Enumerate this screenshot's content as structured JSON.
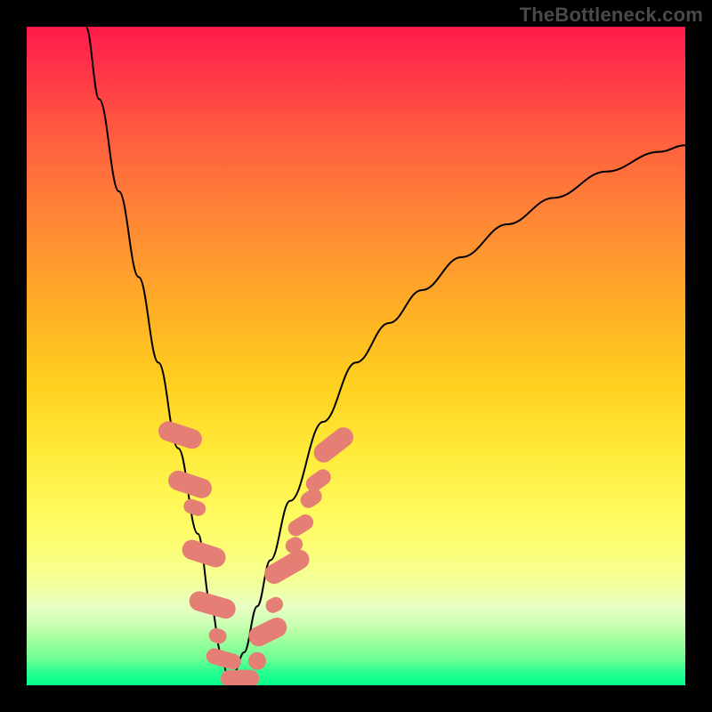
{
  "attribution": "TheBottleneck.com",
  "chart_data": {
    "type": "line",
    "title": "",
    "xlabel": "",
    "ylabel": "",
    "xlim": [
      0,
      100
    ],
    "ylim": [
      0,
      100
    ],
    "grid": false,
    "legend": false,
    "series": [
      {
        "name": "bottleneck-curve",
        "x": [
          9,
          11,
          14,
          17,
          20,
          23,
          26,
          28,
          29.5,
          30.5,
          31.5,
          33,
          35,
          37,
          40,
          45,
          50,
          55,
          60,
          66,
          73,
          80,
          88,
          96,
          100
        ],
        "y": [
          100,
          89,
          75,
          62,
          49,
          36,
          23,
          12,
          5,
          1.5,
          2,
          5,
          12,
          19,
          28,
          40,
          49,
          55,
          60,
          65,
          70,
          74,
          78,
          81,
          82
        ]
      }
    ],
    "markers": {
      "name": "highlight-beads",
      "shape": "rounded-rect",
      "color": "#e57f76",
      "points": [
        {
          "x": 23.3,
          "y": 38,
          "w": 3.0,
          "h": 6.8,
          "rot": -72
        },
        {
          "x": 24.8,
          "y": 30.5,
          "w": 3.0,
          "h": 6.8,
          "rot": -72
        },
        {
          "x": 25.5,
          "y": 27,
          "w": 2.2,
          "h": 3.4,
          "rot": -72
        },
        {
          "x": 26.9,
          "y": 20,
          "w": 3.0,
          "h": 6.8,
          "rot": -72
        },
        {
          "x": 28.2,
          "y": 12.2,
          "w": 3.0,
          "h": 7.2,
          "rot": -74
        },
        {
          "x": 29.0,
          "y": 7.5,
          "w": 2.2,
          "h": 2.7,
          "rot": -74
        },
        {
          "x": 29.9,
          "y": 4.0,
          "w": 2.4,
          "h": 5.4,
          "rot": -74
        },
        {
          "x": 30.8,
          "y": 1.0,
          "w": 2.7,
          "h": 2.7,
          "rot": 0
        },
        {
          "x": 33.0,
          "y": 1.0,
          "w": 4.6,
          "h": 2.7,
          "rot": 0
        },
        {
          "x": 35.0,
          "y": 3.7,
          "w": 2.7,
          "h": 2.7,
          "rot": 64
        },
        {
          "x": 36.6,
          "y": 8.1,
          "w": 3.0,
          "h": 6.1,
          "rot": 64
        },
        {
          "x": 37.6,
          "y": 12.2,
          "w": 2.2,
          "h": 2.7,
          "rot": 64
        },
        {
          "x": 39.5,
          "y": 18,
          "w": 3.0,
          "h": 7.4,
          "rot": 60
        },
        {
          "x": 40.6,
          "y": 21.3,
          "w": 2.2,
          "h": 2.7,
          "rot": 60
        },
        {
          "x": 41.6,
          "y": 24.3,
          "w": 2.4,
          "h": 4.1,
          "rot": 58
        },
        {
          "x": 43.2,
          "y": 28.4,
          "w": 2.4,
          "h": 3.4,
          "rot": 56
        },
        {
          "x": 44.3,
          "y": 31.1,
          "w": 2.4,
          "h": 4.1,
          "rot": 54
        },
        {
          "x": 46.6,
          "y": 36.5,
          "w": 3.0,
          "h": 6.8,
          "rot": 52
        }
      ]
    },
    "gradient_scale": {
      "description": "vertical heat gradient, red (top/high bottleneck) to green (bottom/low bottleneck)",
      "stops": [
        {
          "pos": 0.0,
          "color": "#ff1a4b"
        },
        {
          "pos": 0.5,
          "color": "#ffd21f"
        },
        {
          "pos": 0.88,
          "color": "#e8ffc3"
        },
        {
          "pos": 1.0,
          "color": "#00ff8c"
        }
      ]
    }
  }
}
